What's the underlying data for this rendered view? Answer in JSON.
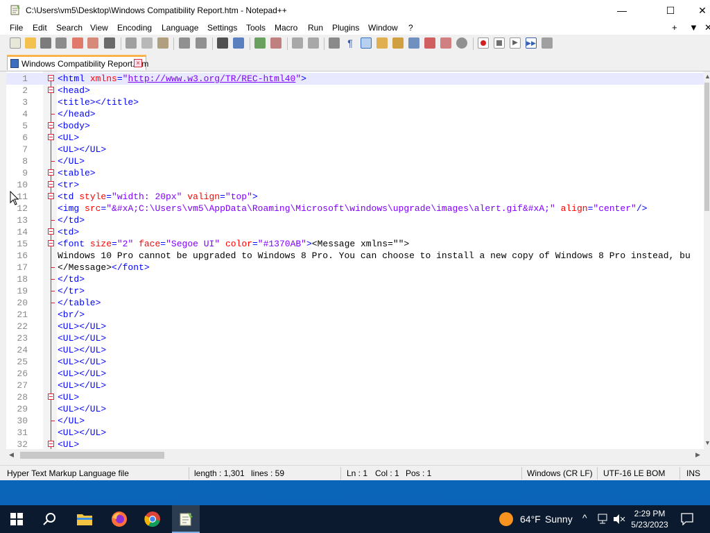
{
  "window": {
    "title": "C:\\Users\\vm5\\Desktop\\Windows Compatibility Report.htm - Notepad++",
    "minimize": "—",
    "maximize": "☐",
    "close": "✕"
  },
  "menu": {
    "items": [
      "File",
      "Edit",
      "Search",
      "View",
      "Encoding",
      "Language",
      "Settings",
      "Tools",
      "Macro",
      "Run",
      "Plugins",
      "Window",
      "?"
    ],
    "right": [
      "+",
      "▼",
      "✕"
    ]
  },
  "tab": {
    "label": "Windows Compatibility Report.htm",
    "close": "×"
  },
  "editor": {
    "lines": [
      {
        "n": "1",
        "fold": "box",
        "html": "<span class='t-tag'>&lt;html</span> <span class='t-attr'>xmlns</span><span class='t-tag'>=</span><span class='t-str'>\"</span><span class='t-url'>http://www.w3.org/TR/REC-html40</span><span class='t-str'>\"</span><span class='t-tag'>&gt;</span>"
      },
      {
        "n": "2",
        "fold": "box",
        "html": "<span class='t-tag'>&lt;head&gt;</span>"
      },
      {
        "n": "3",
        "fold": "line",
        "html": "<span class='t-tag'>&lt;title&gt;&lt;/title&gt;</span>"
      },
      {
        "n": "4",
        "fold": "end",
        "html": "<span class='t-tag'>&lt;/head&gt;</span>"
      },
      {
        "n": "5",
        "fold": "box",
        "html": "<span class='t-tag'>&lt;body&gt;</span>"
      },
      {
        "n": "6",
        "fold": "box",
        "html": "<span class='t-tag'>&lt;UL&gt;</span>"
      },
      {
        "n": "7",
        "fold": "line",
        "html": "<span class='t-tag'>&lt;UL&gt;&lt;/UL&gt;</span>"
      },
      {
        "n": "8",
        "fold": "end",
        "html": "<span class='t-tag'>&lt;/UL&gt;</span>"
      },
      {
        "n": "9",
        "fold": "box",
        "html": "<span class='t-tag'>&lt;table&gt;</span>"
      },
      {
        "n": "10",
        "fold": "box",
        "html": "<span class='t-tag'>&lt;tr&gt;</span>"
      },
      {
        "n": "11",
        "fold": "box",
        "html": "<span class='t-tag'>&lt;td</span> <span class='t-attr'>style</span><span class='t-tag'>=</span><span class='t-str'>\"width: 20px\"</span> <span class='t-attr'>valign</span><span class='t-tag'>=</span><span class='t-str'>\"top\"</span><span class='t-tag'>&gt;</span>"
      },
      {
        "n": "12",
        "fold": "line",
        "html": "<span class='t-tag'>&lt;img</span> <span class='t-attr'>src</span><span class='t-tag'>=</span><span class='t-str'>\"&amp;#xA;C:\\Users\\vm5\\AppData\\Roaming\\Microsoft\\windows\\upgrade\\images\\alert.gif&amp;#xA;\"</span> <span class='t-attr'>align</span><span class='t-tag'>=</span><span class='t-str'>\"center\"</span><span class='t-tag'>/&gt;</span>"
      },
      {
        "n": "13",
        "fold": "end",
        "html": "<span class='t-tag'>&lt;/td&gt;</span>"
      },
      {
        "n": "14",
        "fold": "box",
        "html": "<span class='t-tag'>&lt;td&gt;</span>"
      },
      {
        "n": "15",
        "fold": "box",
        "html": "<span class='t-tag'>&lt;font</span> <span class='t-attr'>size</span><span class='t-tag'>=</span><span class='t-str'>\"2\"</span> <span class='t-attr'>face</span><span class='t-tag'>=</span><span class='t-str'>\"Segoe UI\"</span> <span class='t-attr'>color</span><span class='t-tag'>=</span><span class='t-str'>\"#1370AB\"</span><span class='t-tag'>&gt;</span><span class='t-text'>&lt;Message xmlns=\"\"&gt;</span>"
      },
      {
        "n": "16",
        "fold": "line",
        "html": "<span class='t-text'>Windows 10 Pro cannot be upgraded to Windows 8 Pro. You can choose to install a new copy of Windows 8 Pro instead, bu</span>"
      },
      {
        "n": "17",
        "fold": "end",
        "html": "<span class='t-text'>&lt;/Message&gt;</span><span class='t-tag'>&lt;/font&gt;</span>"
      },
      {
        "n": "18",
        "fold": "end",
        "html": "<span class='t-tag'>&lt;/td&gt;</span>"
      },
      {
        "n": "19",
        "fold": "end",
        "html": "<span class='t-tag'>&lt;/tr&gt;</span>"
      },
      {
        "n": "20",
        "fold": "end",
        "html": "<span class='t-tag'>&lt;/table&gt;</span>"
      },
      {
        "n": "21",
        "fold": "line",
        "html": "<span class='t-tag'>&lt;br/&gt;</span>"
      },
      {
        "n": "22",
        "fold": "line",
        "html": "<span class='t-tag'>&lt;UL&gt;&lt;/UL&gt;</span>"
      },
      {
        "n": "23",
        "fold": "line",
        "html": "<span class='t-tag'>&lt;UL&gt;&lt;/UL&gt;</span>"
      },
      {
        "n": "24",
        "fold": "line",
        "html": "<span class='t-tag'>&lt;UL&gt;&lt;/UL&gt;</span>"
      },
      {
        "n": "25",
        "fold": "line",
        "html": "<span class='t-tag'>&lt;UL&gt;&lt;/UL&gt;</span>"
      },
      {
        "n": "26",
        "fold": "line",
        "html": "<span class='t-tag'>&lt;UL&gt;&lt;/UL&gt;</span>"
      },
      {
        "n": "27",
        "fold": "line",
        "html": "<span class='t-tag'>&lt;UL&gt;&lt;/UL&gt;</span>"
      },
      {
        "n": "28",
        "fold": "box",
        "html": "<span class='t-tag'>&lt;UL&gt;</span>"
      },
      {
        "n": "29",
        "fold": "line",
        "html": "<span class='t-tag'>&lt;UL&gt;&lt;/UL&gt;</span>"
      },
      {
        "n": "30",
        "fold": "end",
        "html": "<span class='t-tag'>&lt;/UL&gt;</span>"
      },
      {
        "n": "31",
        "fold": "line",
        "html": "<span class='t-tag'>&lt;UL&gt;&lt;/UL&gt;</span>"
      },
      {
        "n": "32",
        "fold": "box",
        "html": "<span class='t-tag'>&lt;UL&gt;</span>"
      }
    ]
  },
  "status": {
    "file_type": "Hyper Text Markup Language file",
    "length": "length : 1,301",
    "lines": "lines : 59",
    "ln": "Ln : 1",
    "col": "Col : 1",
    "pos": "Pos : 1",
    "eol": "Windows (CR LF)",
    "encoding": "UTF-16 LE BOM",
    "mode": "INS"
  },
  "taskbar": {
    "weather_temp": "64°F",
    "weather_desc": "Sunny",
    "time": "2:29 PM",
    "date": "5/23/2023"
  },
  "colors": {
    "tag": "#0000ff",
    "attr": "#ff0000",
    "string": "#8000ff",
    "tab_accent": "#fab34a",
    "taskbar": "#0b1a2e"
  }
}
